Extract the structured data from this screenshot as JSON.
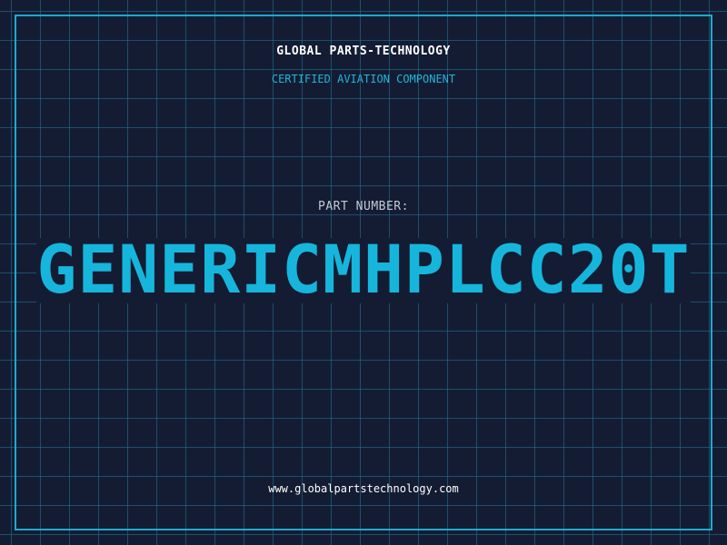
{
  "header": {
    "company": "GLOBAL PARTS-TECHNOLOGY",
    "tagline": "CERTIFIED AVIATION COMPONENT"
  },
  "part": {
    "label": "PART NUMBER:",
    "number": "GENERICMHPLCC20T"
  },
  "footer": {
    "website": "www.globalpartstechnology.com"
  },
  "colors": {
    "background": "#141c33",
    "grid": "#22789a",
    "accent": "#16b6dc",
    "frame": "#1fa9cf",
    "text_primary": "#ffffff",
    "text_muted": "#c3c9d6"
  }
}
